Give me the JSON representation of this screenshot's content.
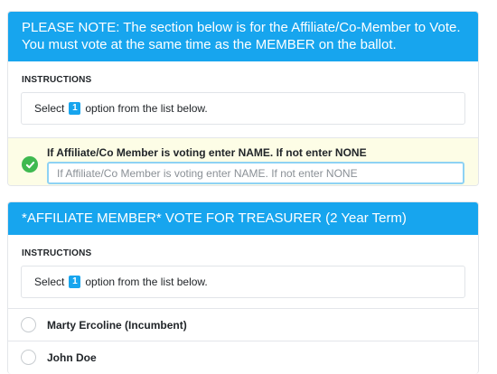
{
  "section1": {
    "header": "PLEASE NOTE: The section below is for the Affiliate/Co-Member to Vote. You must vote at the same time as the MEMBER on the ballot.",
    "instructions_label": "INSTRUCTIONS",
    "select_prefix": "Select",
    "select_count": "1",
    "select_suffix": "option from the list below.",
    "question_label": "If Affiliate/Co Member is voting enter NAME. If not enter NONE",
    "input_placeholder": "If Affiliate/Co Member is voting enter NAME. If not enter NONE",
    "input_value": "",
    "status_icon": "check-circle-icon",
    "status_color": "#3fb950"
  },
  "section2": {
    "header": "*AFFILIATE MEMBER* VOTE FOR TREASURER (2 Year Term)",
    "instructions_label": "INSTRUCTIONS",
    "select_prefix": "Select",
    "select_count": "1",
    "select_suffix": "option from the list below.",
    "options": [
      {
        "label": "Marty Ercoline (Incumbent)"
      },
      {
        "label": "John Doe"
      }
    ]
  },
  "colors": {
    "header_bg": "#17a5ee",
    "answer_row_bg": "#fdfde6"
  }
}
